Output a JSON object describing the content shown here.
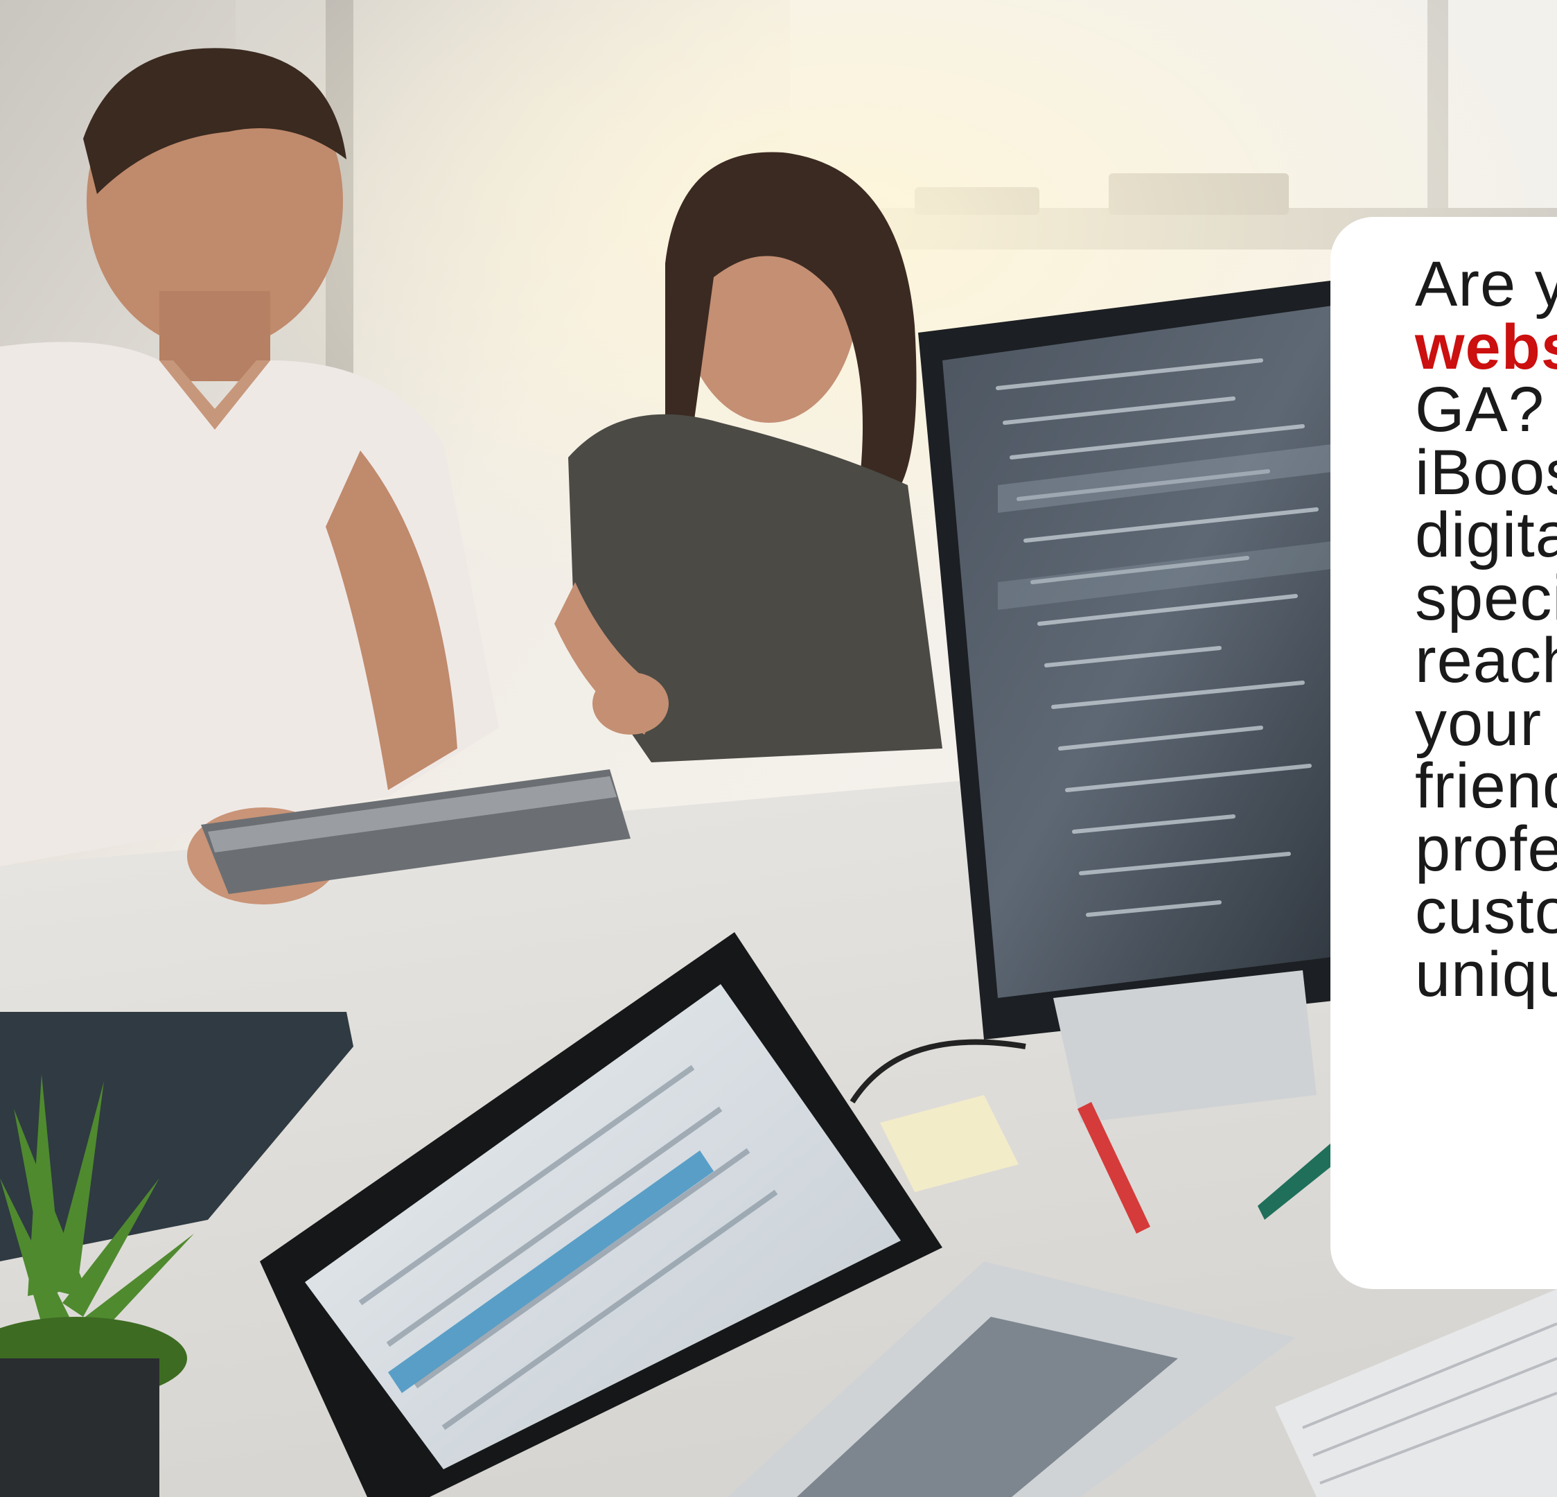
{
  "card": {
    "lines": [
      {
        "text": "Are you looking for a",
        "highlight": false
      },
      {
        "text": "website design in",
        "highlight": true
      },
      {
        "text": "GA? Then look no further.",
        "highlight": false
      },
      {
        "text": "iBoost Web is a top",
        "highlight": false
      },
      {
        "text": "digital marketing agency",
        "highlight": false
      },
      {
        "text": "specializing in helping you",
        "highlight": false
      },
      {
        "text": "reach new customers with",
        "highlight": false
      },
      {
        "text": "your brand. Our",
        "highlight": false
      },
      {
        "text": "friendly and",
        "highlight": false
      },
      {
        "text": "professional team creates",
        "highlight": false
      },
      {
        "text": "custom websites for your",
        "highlight": false
      },
      {
        "text": "unique needs.",
        "highlight": false
      }
    ]
  },
  "colors": {
    "accent": "#cc0f0f",
    "text": "#1a1a1a",
    "card_bg": "#ffffff"
  }
}
